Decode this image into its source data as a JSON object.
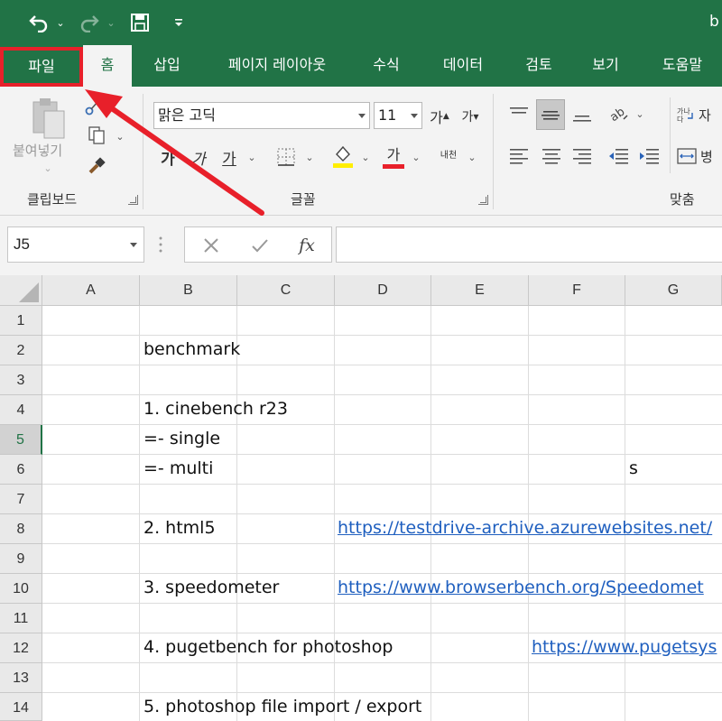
{
  "title_text": "b",
  "tabs": [
    {
      "label": "파일"
    },
    {
      "label": "홈"
    },
    {
      "label": "삽입"
    },
    {
      "label": "페이지 레이아웃"
    },
    {
      "label": "수식"
    },
    {
      "label": "데이터"
    },
    {
      "label": "검토"
    },
    {
      "label": "보기"
    },
    {
      "label": "도움말"
    }
  ],
  "ribbon": {
    "clipboard": {
      "paste_label": "붙여넣기",
      "group_label": "클립보드"
    },
    "font": {
      "font_name": "맑은 고딕",
      "font_size": "11",
      "grow_label": "가",
      "shrink_label": "가",
      "bold_label": "가",
      "italic_label": "가",
      "underline_label": "가",
      "font_color_label": "가",
      "phonetic_label": "내천",
      "group_label": "글꼴"
    },
    "alignment": {
      "wrap_label": "자",
      "merge_label": "병",
      "group_label": "맞춤"
    }
  },
  "formula_bar": {
    "name_box": "J5",
    "fx_label": "fx",
    "formula": ""
  },
  "columns": [
    "A",
    "B",
    "C",
    "D",
    "E",
    "F",
    "G"
  ],
  "rows": [
    "1",
    "2",
    "3",
    "4",
    "5",
    "6",
    "7",
    "8",
    "9",
    "10",
    "11",
    "12",
    "13",
    "14"
  ],
  "cells": {
    "b2": "benchmark",
    "b4": "1. cinebench r23",
    "b5": "=- single",
    "b6": "=- multi",
    "g6": "s",
    "b8": "2. html5",
    "d8": "https://testdrive-archive.azurewebsites.net/",
    "b10": "3. speedometer",
    "d10": "https://www.browserbench.org/Speedomet",
    "b12": "4. pugetbench for photoshop",
    "f12": "https://www.pugetsys",
    "b14": "5. photoshop file import / export"
  },
  "colors": {
    "excel_green": "#217346",
    "annotation_red": "#e8202a",
    "link_blue": "#1f5fbf"
  }
}
